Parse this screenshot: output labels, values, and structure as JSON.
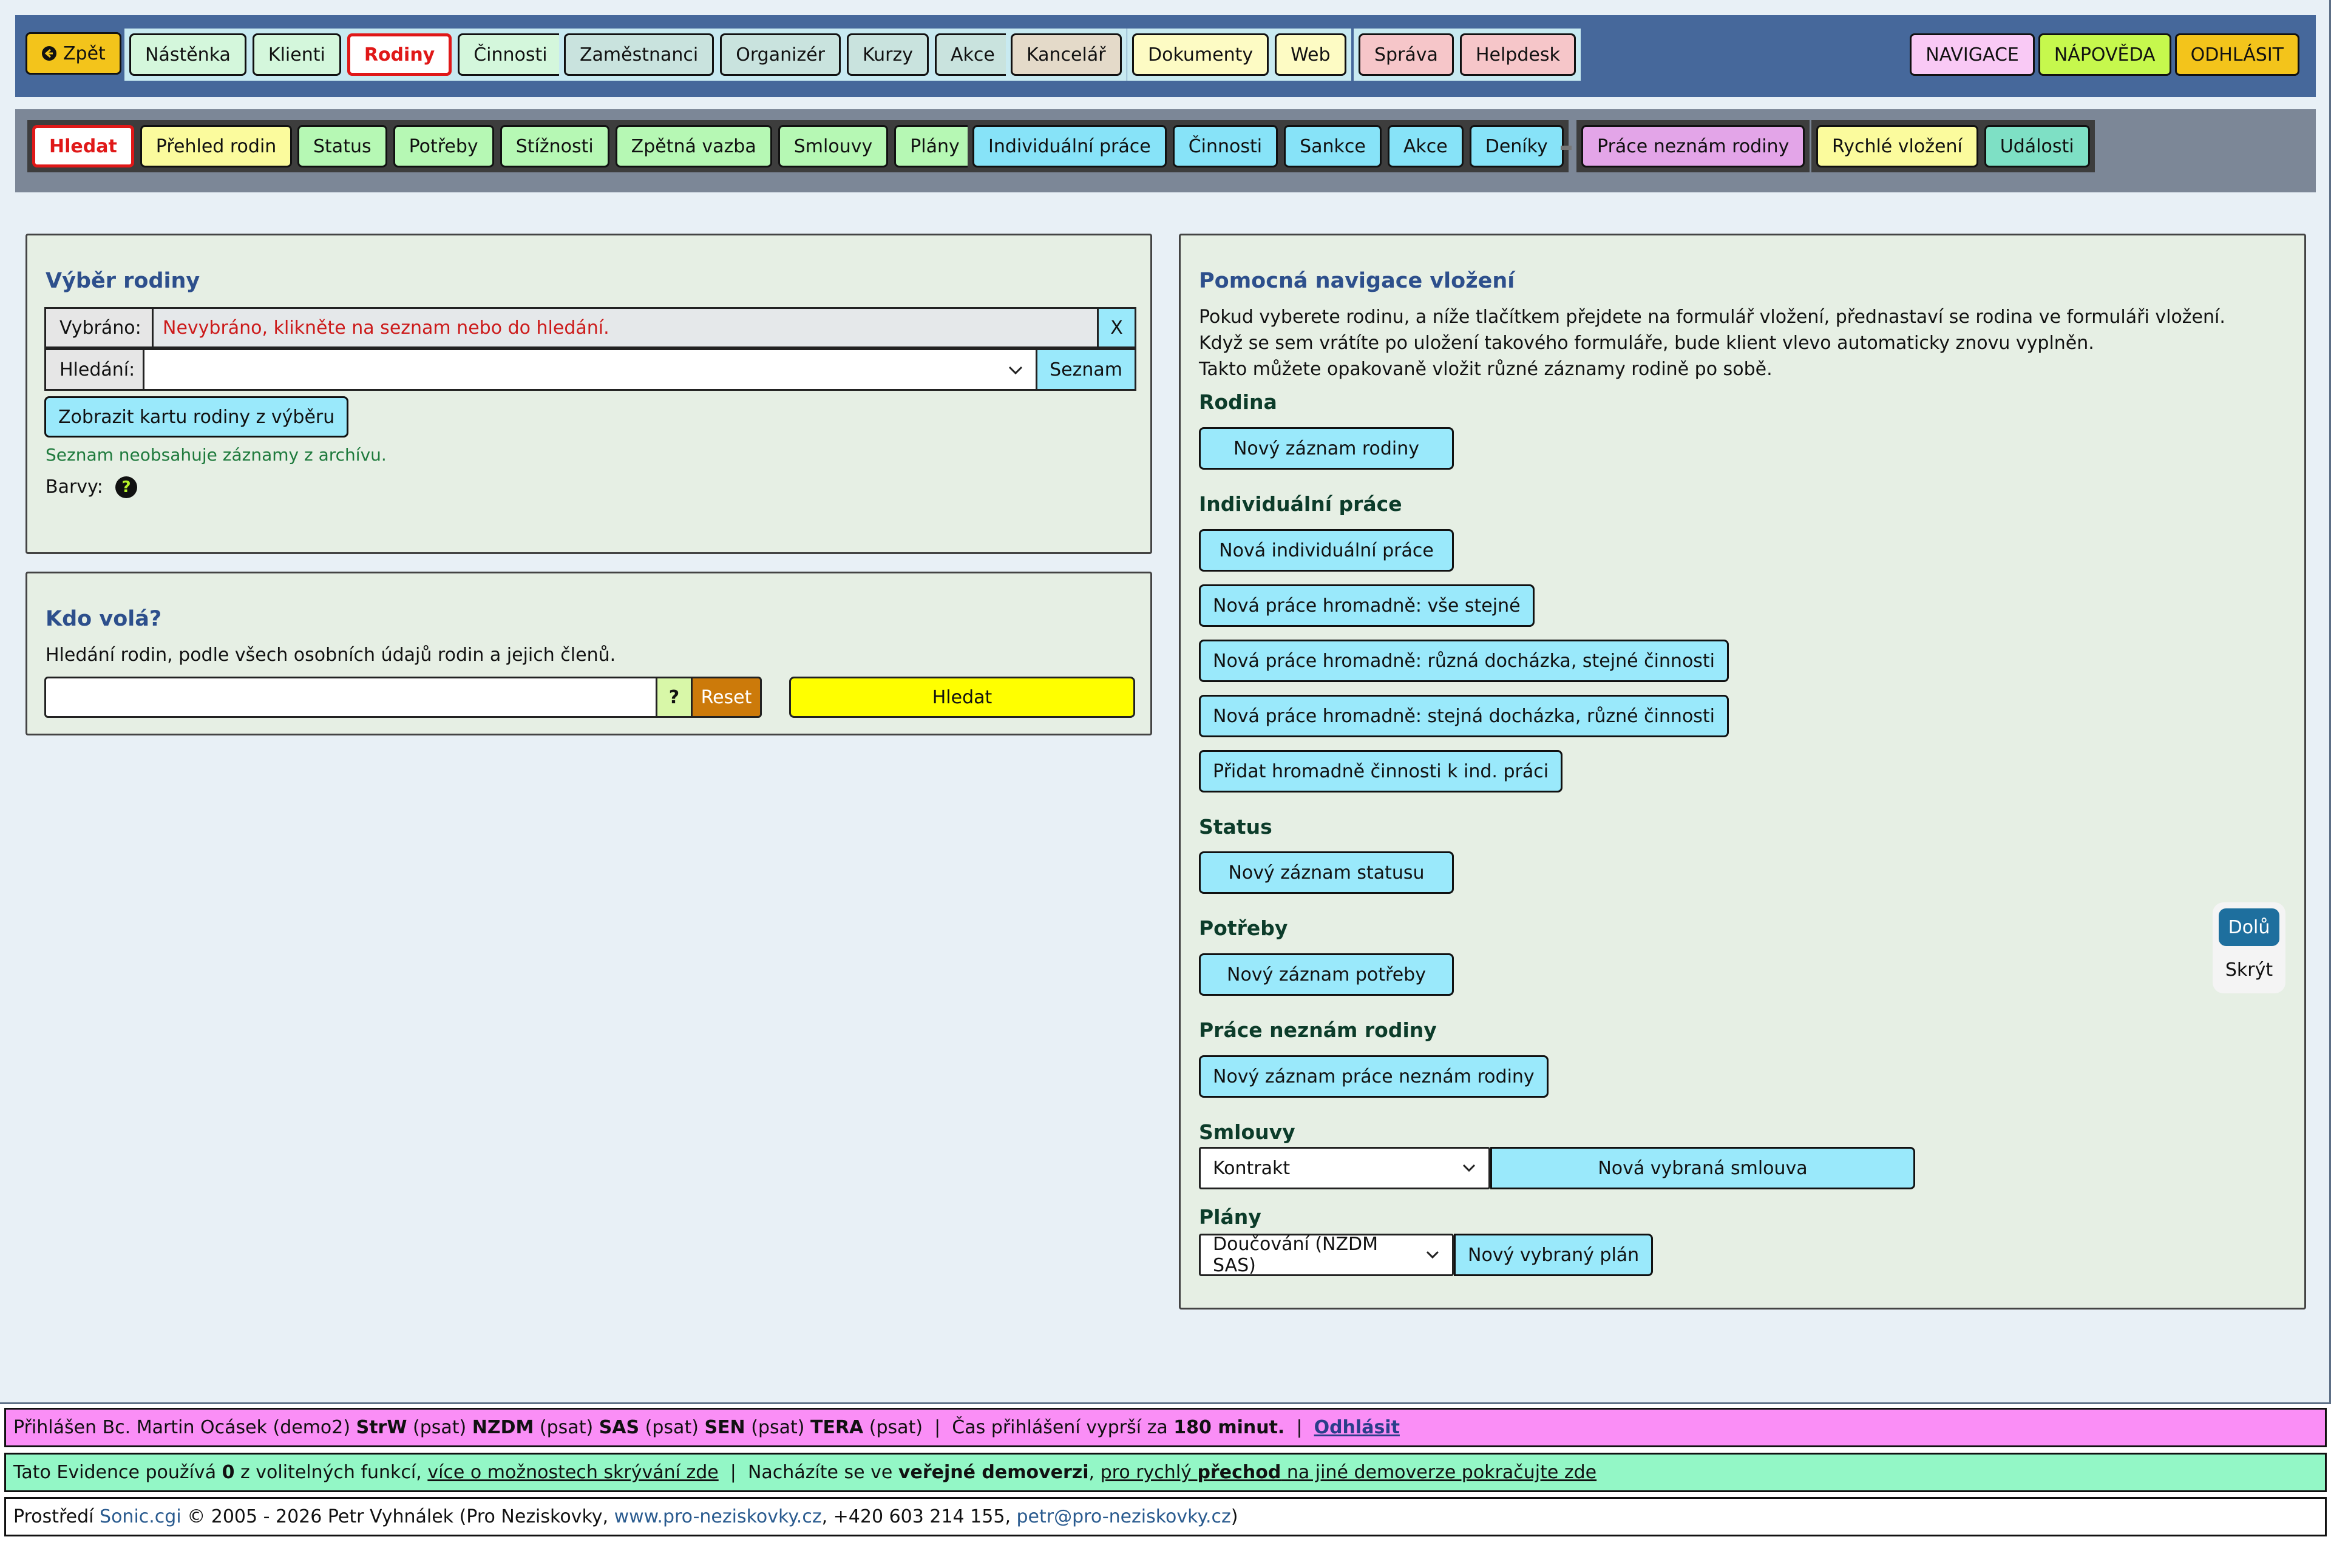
{
  "topnav": {
    "back": "Zpět",
    "group1": [
      "Nástěnka",
      "Klienti",
      "Rodiny",
      "Činnosti"
    ],
    "group2": [
      "Zaměstnanci",
      "Organizér",
      "Kurzy",
      "Akce"
    ],
    "group3": [
      "Kancelář"
    ],
    "group4": [
      "Dokumenty",
      "Web"
    ],
    "group5": [
      "Správa",
      "Helpdesk"
    ],
    "right": [
      "NAVIGACE",
      "NÁPOVĚDA",
      "ODHLÁSIT"
    ]
  },
  "subnav": {
    "group1": [
      "Hledat",
      "Přehled rodin"
    ],
    "group2": [
      "Status",
      "Potřeby",
      "Stížnosti",
      "Zpětná vazba",
      "Smlouvy",
      "Plány"
    ],
    "group3": [
      "Individuální práce",
      "Činnosti",
      "Sankce",
      "Akce",
      "Deníky"
    ],
    "group4": [
      "Práce neznám rodiny"
    ],
    "group5": [
      "Rychlé vložení",
      "Události"
    ]
  },
  "vyber": {
    "title": "Výběr rodiny",
    "selected_label": "Vybráno:",
    "selected_value": "Nevybráno, klikněte na seznam nebo do hledání.",
    "clear": "X",
    "search_label": "Hledání:",
    "list_button": "Seznam",
    "show_card": "Zobrazit kartu rodiny z výběru",
    "note": "Seznam neobsahuje záznamy z archívu.",
    "colors_label": "Barvy:",
    "help_glyph": "?"
  },
  "kdo": {
    "title": "Kdo volá?",
    "desc": "Hledání rodin, podle všech osobních údajů rodin a jejich členů.",
    "q": "?",
    "reset": "Reset",
    "search": "Hledat"
  },
  "nav": {
    "title": "Pomocná navigace vložení",
    "p1": "Pokud vyberete rodinu, a níže tlačítkem přejdete na formulář vložení, přednastaví se rodina ve formuláři vložení.",
    "p2": "Když se sem vrátíte po uložení takového formuláře, bude klient vlevo automaticky znovu vyplněn.",
    "p3": "Takto můžete opakovaně vložit různé záznamy rodině po sobě.",
    "s_rodina": "Rodina",
    "b_rodina": "Nový záznam rodiny",
    "s_ind": "Individuální práce",
    "b_ind1": "Nová individuální práce",
    "b_ind2": "Nová práce hromadně: vše stejné",
    "b_ind3": "Nová práce hromadně: různá docházka, stejné činnosti",
    "b_ind4": "Nová práce hromadně: stejná docházka, různé činnosti",
    "b_ind5": "Přidat hromadně činnosti k ind. práci",
    "s_status": "Status",
    "b_status": "Nový záznam statusu",
    "s_potreby": "Potřeby",
    "b_potreby": "Nový záznam potřeby",
    "s_prace": "Práce neznám rodiny",
    "b_prace": "Nový záznam práce neznám rodiny",
    "s_smlouvy": "Smlouvy",
    "smlouva_select": "Kontrakt",
    "b_smlouva": "Nová vybraná smlouva",
    "s_plany": "Plány",
    "plan_select": "Doučování (NZDM SAS)",
    "b_plan": "Nový vybraný plán"
  },
  "floating": {
    "down": "Dolů",
    "hide": "Skrýt"
  },
  "footer": {
    "l1_a": "Přihlášen Bc. Martin Ocásek (demo2) ",
    "l1_b1": "StrW",
    "l1_c1": " (psat) ",
    "l1_b2": "NZDM",
    "l1_c2": " (psat) ",
    "l1_b3": "SAS",
    "l1_c3": " (psat) ",
    "l1_b4": "SEN",
    "l1_c4": " (psat) ",
    "l1_b5": "TERA",
    "l1_c5": " (psat)  |  Čas přihlášení vyprší za ",
    "l1_b6": "180 minut.",
    "l1_c6": "  |  ",
    "l1_link": "Odhlásit",
    "l2_a": "Tato Evidence používá ",
    "l2_b": "0",
    "l2_c": " z volitelných funkcí, ",
    "l2_link1": "více o možnostech skrývání zde",
    "l2_d": "  |  Nacházíte se ve ",
    "l2_e": "veřejné demoverzi",
    "l2_f": ", ",
    "l2_link2a": "pro rychlý ",
    "l2_link2b": "přechod",
    "l2_link2c": " na jiné demoverze pokračujte zde",
    "l3_a": "Prostředí ",
    "l3_sonic": "Sonic.cgi",
    "l3_b": " © 2005 - 2026 Petr Vyhnálek (Pro Neziskovky, ",
    "l3_web": "www.pro-neziskovky.cz",
    "l3_c": ", +420 603 214 155, ",
    "l3_mail": "petr@pro-neziskovky.cz",
    "l3_d": ")"
  }
}
